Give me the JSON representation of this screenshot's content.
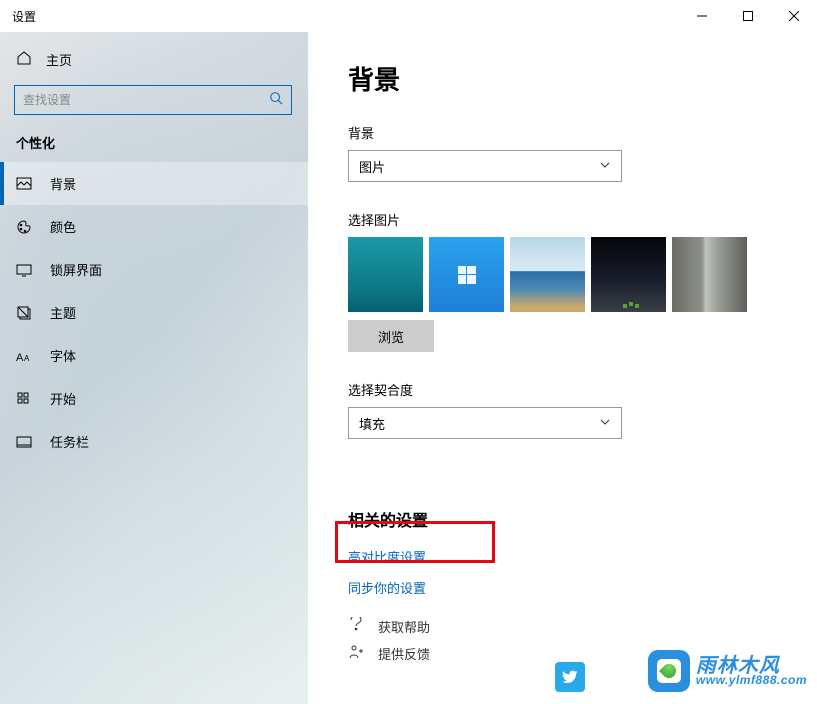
{
  "window": {
    "title": "设置"
  },
  "titlebar_controls": {
    "minimize": "minimize",
    "maximize": "maximize",
    "close": "close"
  },
  "sidebar": {
    "home_label": "主页",
    "search_placeholder": "查找设置",
    "section_title": "个性化",
    "items": [
      {
        "label": "背景"
      },
      {
        "label": "颜色"
      },
      {
        "label": "锁屏界面"
      },
      {
        "label": "主题"
      },
      {
        "label": "字体"
      },
      {
        "label": "开始"
      },
      {
        "label": "任务栏"
      }
    ]
  },
  "main": {
    "page_title": "背景",
    "background_label": "背景",
    "background_value": "图片",
    "choose_picture_label": "选择图片",
    "browse_button": "浏览",
    "fit_label": "选择契合度",
    "fit_value": "填充",
    "related_heading": "相关的设置",
    "links": {
      "high_contrast": "高对比度设置",
      "sync": "同步你的设置"
    },
    "help": {
      "get_help": "获取帮助",
      "feedback": "提供反馈"
    }
  },
  "watermark": {
    "main": "雨林木风",
    "sub": "www.ylmf888.com"
  }
}
